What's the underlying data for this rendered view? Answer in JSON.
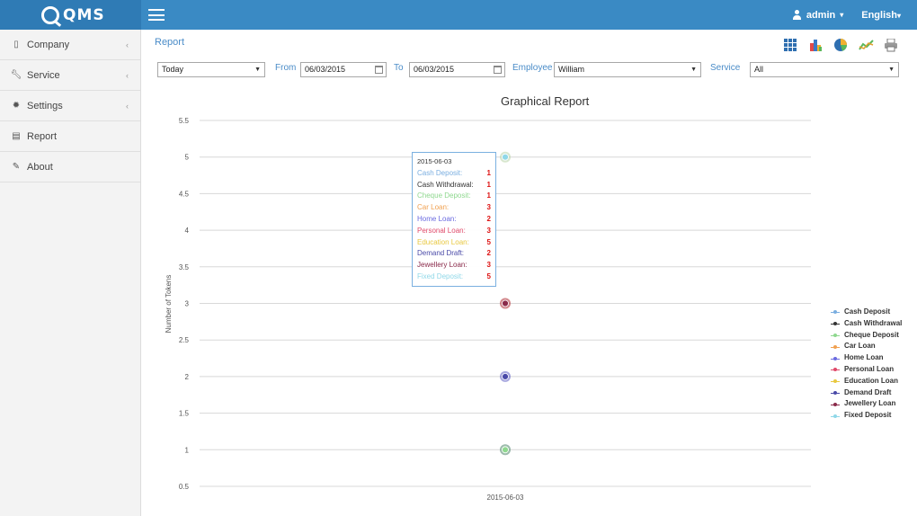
{
  "app": {
    "logo_text": "QMS"
  },
  "header": {
    "user_label": "admin",
    "language_label": "English"
  },
  "sidebar": {
    "items": [
      {
        "label": "Company",
        "icon": "building-icon"
      },
      {
        "label": "Service",
        "icon": "wrench-icon"
      },
      {
        "label": "Settings",
        "icon": "gear-icon"
      },
      {
        "label": "Report",
        "icon": "report-icon"
      },
      {
        "label": "About",
        "icon": "edit-icon"
      }
    ]
  },
  "page": {
    "breadcrumb": "Report"
  },
  "toolbar": {
    "icons": [
      "table-view-icon",
      "bar-chart-icon",
      "pie-chart-icon",
      "line-chart-icon",
      "print-icon"
    ]
  },
  "filters": {
    "period": "Today",
    "from_label": "From",
    "from_date": "06/03/2015",
    "to_label": "To",
    "to_date": "06/03/2015",
    "employee_label": "Employee",
    "employee": "William",
    "service_label": "Service",
    "service": "All"
  },
  "tooltip": {
    "date": "2015-06-03",
    "rows": [
      {
        "label": "Cash Deposit:",
        "value": "1",
        "color": "#7aaee0"
      },
      {
        "label": "Cash Withdrawal:",
        "value": "1",
        "color": "#333333"
      },
      {
        "label": "Cheque Deposit:",
        "value": "1",
        "color": "#8fd88f"
      },
      {
        "label": "Car Loan:",
        "value": "3",
        "color": "#f0a050"
      },
      {
        "label": "Home Loan:",
        "value": "2",
        "color": "#6a6ae0"
      },
      {
        "label": "Personal Loan:",
        "value": "3",
        "color": "#e04a6a"
      },
      {
        "label": "Education Loan:",
        "value": "5",
        "color": "#e8c840"
      },
      {
        "label": "Demand Draft:",
        "value": "2",
        "color": "#4a4aa8"
      },
      {
        "label": "Jewellery Loan:",
        "value": "3",
        "color": "#8a2a4a"
      },
      {
        "label": "Fixed Deposit:",
        "value": "5",
        "color": "#90d8e8"
      }
    ]
  },
  "chart_data": {
    "type": "line",
    "title": "Graphical Report",
    "ylabel": "Number of Tokens",
    "xlabel": "",
    "x": [
      "2015-06-03"
    ],
    "ylim": [
      0.5,
      5.5
    ],
    "yticks": [
      "0.5",
      "1",
      "1.5",
      "2",
      "2.5",
      "3",
      "3.5",
      "4",
      "4.5",
      "5",
      "5.5"
    ],
    "grid": true,
    "legend_position": "right",
    "series": [
      {
        "name": "Cash Deposit",
        "values": [
          1
        ],
        "color": "#7aaee0"
      },
      {
        "name": "Cash Withdrawal",
        "values": [
          1
        ],
        "color": "#333333"
      },
      {
        "name": "Cheque Deposit",
        "values": [
          1
        ],
        "color": "#8fd88f"
      },
      {
        "name": "Car Loan",
        "values": [
          3
        ],
        "color": "#f0a050"
      },
      {
        "name": "Home Loan",
        "values": [
          2
        ],
        "color": "#6a6ae0"
      },
      {
        "name": "Personal Loan",
        "values": [
          3
        ],
        "color": "#e04a6a"
      },
      {
        "name": "Education Loan",
        "values": [
          5
        ],
        "color": "#e8c840"
      },
      {
        "name": "Demand Draft",
        "values": [
          2
        ],
        "color": "#4a4aa8"
      },
      {
        "name": "Jewellery Loan",
        "values": [
          3
        ],
        "color": "#8a2a4a"
      },
      {
        "name": "Fixed Deposit",
        "values": [
          5
        ],
        "color": "#90d8e8"
      }
    ]
  }
}
